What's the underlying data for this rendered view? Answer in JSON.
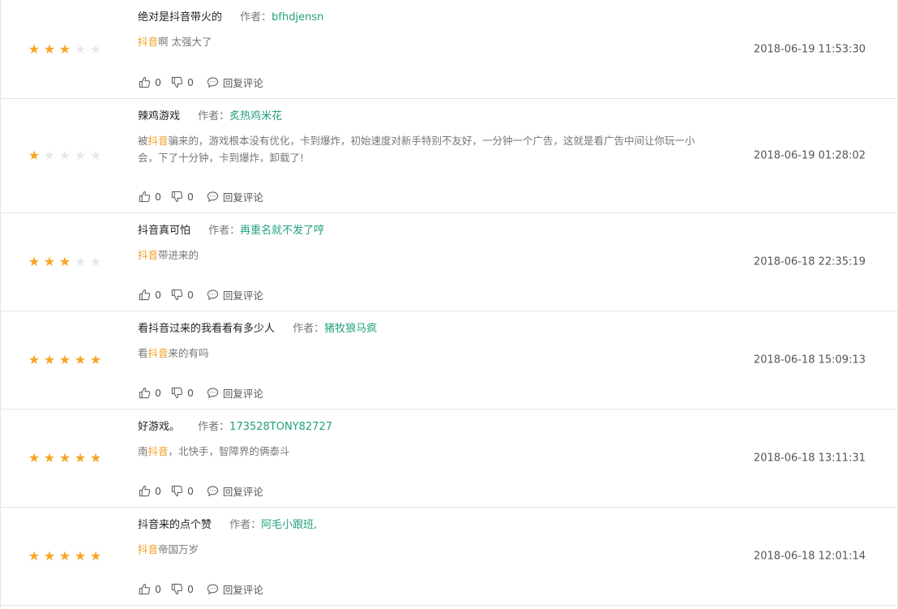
{
  "labels": {
    "author_prefix": "作者：",
    "reply": "回复评论"
  },
  "colors": {
    "star_on": "#f6a623",
    "star_off": "#e8e8e8",
    "author": "#21a07f",
    "keyword": "#f39a1d"
  },
  "reviews": [
    {
      "title": "绝对是抖音带火的",
      "author": "bfhdjensn",
      "rating": 3,
      "body_before": "",
      "body_keyword": "抖音",
      "body_after": "啊 太强大了",
      "likes": "0",
      "dislikes": "0",
      "time": "2018-06-19 11:53:30"
    },
    {
      "title": "辣鸡游戏",
      "author": "炙热鸡米花",
      "rating": 1,
      "body_before": "被",
      "body_keyword": "抖音",
      "body_after": "骗来的，游戏根本没有优化，卡到爆炸，初始速度对新手特别不友好，一分钟一个广告，这就是看广告中间让你玩一小会，下了十分钟，卡到爆炸，卸载了!",
      "likes": "0",
      "dislikes": "0",
      "time": "2018-06-19 01:28:02"
    },
    {
      "title": "抖音真可怕",
      "author": "再重名就不发了哼",
      "rating": 3,
      "body_before": "",
      "body_keyword": "抖音",
      "body_after": "带进来的",
      "likes": "0",
      "dislikes": "0",
      "time": "2018-06-18 22:35:19"
    },
    {
      "title": "看抖音过来的我看看有多少人",
      "author": "猪牧狼马疯",
      "rating": 5,
      "body_before": "看",
      "body_keyword": "抖音",
      "body_after": "来的有吗",
      "likes": "0",
      "dislikes": "0",
      "time": "2018-06-18 15:09:13"
    },
    {
      "title": "好游戏。",
      "author": "173528TONY82727",
      "rating": 5,
      "body_before": "南",
      "body_keyword": "抖音",
      "body_after": "，北快手，智障界的俩泰斗",
      "likes": "0",
      "dislikes": "0",
      "time": "2018-06-18 13:11:31"
    },
    {
      "title": "抖音来的点个赞",
      "author": "阿毛小跟班,",
      "rating": 5,
      "body_before": "",
      "body_keyword": "抖音",
      "body_after": "帝国万岁",
      "likes": "0",
      "dislikes": "0",
      "time": "2018-06-18 12:01:14"
    }
  ]
}
